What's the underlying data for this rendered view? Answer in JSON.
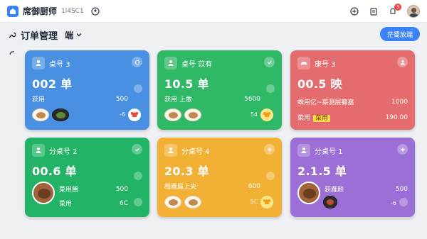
{
  "app": {
    "name": "席御厨师",
    "subtitle": "1l4SC1"
  },
  "header": {
    "page_title": "订单管理",
    "mode": "端",
    "action_button": "茫蜀放端"
  },
  "colors": {
    "blue": "#4a90e2",
    "green": "#2fb866",
    "red": "#e46b6e",
    "teal": "#22b366",
    "yellow": "#f2b134",
    "purple": "#9b6fd6"
  },
  "cards": [
    {
      "title": "桌号 3",
      "big": "002 单",
      "line1_label": "获用",
      "line1_value": "500",
      "extra": "-6"
    },
    {
      "title": "桌号 苡有",
      "big": "10.5 单",
      "line1_label": "获用 上敢",
      "line1_value": "5600",
      "extra": "54"
    },
    {
      "title": "康号 3",
      "big": "00.5 映",
      "line1_label": "蛛用亿~菜测层癫嘉",
      "line1_value": "1000",
      "line2_label": "菜用",
      "line2_tag": "菜用",
      "line2_value": "190.00"
    },
    {
      "title": "分桌号 2",
      "big": "00.6 单",
      "line1_label": "菜用餚",
      "line1_value": "500",
      "line2_label": "菜用",
      "line2_value": "6C"
    },
    {
      "title": "分桌号 4",
      "big": "20.3 单",
      "line1_label": "档雁属上央",
      "line1_value": "600",
      "extra": "5C"
    },
    {
      "title": "分桌号 1",
      "big": "2.1.5 单",
      "line1_label": "荻雁颜",
      "line1_value": "500",
      "line2_label": "",
      "line2_value": "-6"
    }
  ]
}
